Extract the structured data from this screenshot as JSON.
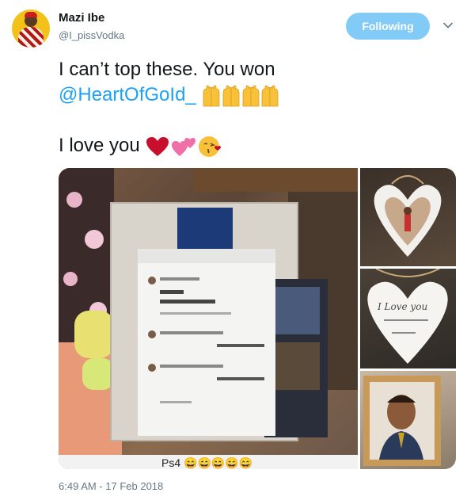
{
  "user": {
    "display_name": "Mazi Ibe",
    "handle": "@I_pissVodka"
  },
  "follow_button": {
    "label": "Following"
  },
  "tweet": {
    "line1": "I can’t top these. You won",
    "mention": "@HeartOfGoId_",
    "line3": "I love you"
  },
  "media": {
    "main_caption": "Ps4 😄😄😄😄😄",
    "note_text": "I Love you"
  },
  "timestamp": "6:49 AM - 17 Feb 2018",
  "colors": {
    "accent": "#1da1f2",
    "text": "#14171a",
    "muted": "#657786"
  }
}
